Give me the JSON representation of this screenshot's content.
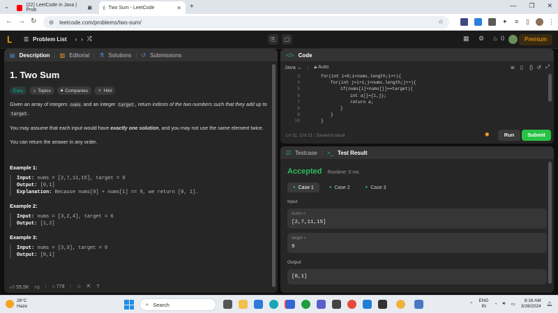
{
  "browser": {
    "tabs": [
      {
        "title": "(22) LeetCode in Java | Prob"
      },
      {
        "title": "Two Sum - LeetCode"
      }
    ],
    "url": "leetcode.com/problems/two-sum/"
  },
  "lc_header": {
    "problem_list": "Problem List",
    "streak": "0",
    "premium": "Premium"
  },
  "description": {
    "tabs": [
      "Description",
      "Editorial",
      "Solutions",
      "Submissions"
    ],
    "title": "1. Two Sum",
    "tags": [
      "Easy",
      "Topics",
      "Companies",
      "Hint"
    ],
    "p1_a": "Given an array of integers ",
    "p1_code1": "nums",
    "p1_b": " and an integer ",
    "p1_code2": "target",
    "p1_c": ", return ",
    "p1_em": "indices of the two numbers such that they add up to",
    "p1_code3": "target",
    "p1_d": ".",
    "p2_a": "You may assume that each input would have ",
    "p2_b": "exactly one solution",
    "p2_c": ", and you may not use the ",
    "p2_d": "same",
    "p2_e": " element twice.",
    "p3": "You can return the answer in any order.",
    "examples": [
      {
        "label": "Example 1:",
        "input": "nums = [2,7,11,15], target = 9",
        "output": "[0,1]",
        "explanation": "Because nums[0] + nums[1] == 9, we return [0, 1]."
      },
      {
        "label": "Example 2:",
        "input": "nums = [3,2,4], target = 6",
        "output": "[1,2]"
      },
      {
        "label": "Example 3:",
        "input": "nums = [3,3], target = 6",
        "output": "[0,1]"
      }
    ],
    "input_label": "Input:",
    "output_label": "Output:",
    "explanation_label": "Explanation:",
    "likes": "55.5K",
    "comments": "779"
  },
  "code": {
    "title": "Code",
    "language": "Java",
    "mode": "Auto",
    "lines": [
      {
        "n": "3",
        "text": "for(int i=0;i<nums.length;i++){",
        "indent": 0
      },
      {
        "n": "4",
        "text": "for(int j=i+1;j<nums.length;j++){",
        "indent": 1
      },
      {
        "n": "5",
        "text": "if(nums[i]+nums[j]==target){",
        "indent": 2
      },
      {
        "n": "6",
        "text": "int a[]={i,j};",
        "indent": 3
      },
      {
        "n": "7",
        "text": "return a;",
        "indent": 3
      },
      {
        "n": "8",
        "text": "}",
        "indent": 2
      },
      {
        "n": "9",
        "text": "}",
        "indent": 1
      },
      {
        "n": "10",
        "text": "}",
        "indent": 0
      }
    ],
    "status": "Ln 11, Col 21",
    "saved": "Saved to local",
    "run": "Run",
    "submit": "Submit"
  },
  "result": {
    "tabs": [
      "Testcase",
      "Test Result"
    ],
    "status": "Accepted",
    "runtime": "Runtime: 0 ms",
    "cases": [
      "Case 1",
      "Case 2",
      "Case 3"
    ],
    "input_label": "Input",
    "params": [
      {
        "name": "nums =",
        "value": "[2,7,11,15]"
      },
      {
        "name": "target =",
        "value": "9"
      }
    ],
    "output_label": "Output",
    "output_value": "[0,1]"
  },
  "taskbar": {
    "temp": "26°C",
    "weather": "Haze",
    "search": "Search",
    "lang1": "ENG",
    "lang2": "IN",
    "time": "8:16 AM",
    "date": "3/28/2024"
  },
  "colors": {
    "accepted": "#2cbb5d",
    "submit": "#28c244",
    "brand": "#ffa116",
    "easy": "#00b8a3"
  }
}
